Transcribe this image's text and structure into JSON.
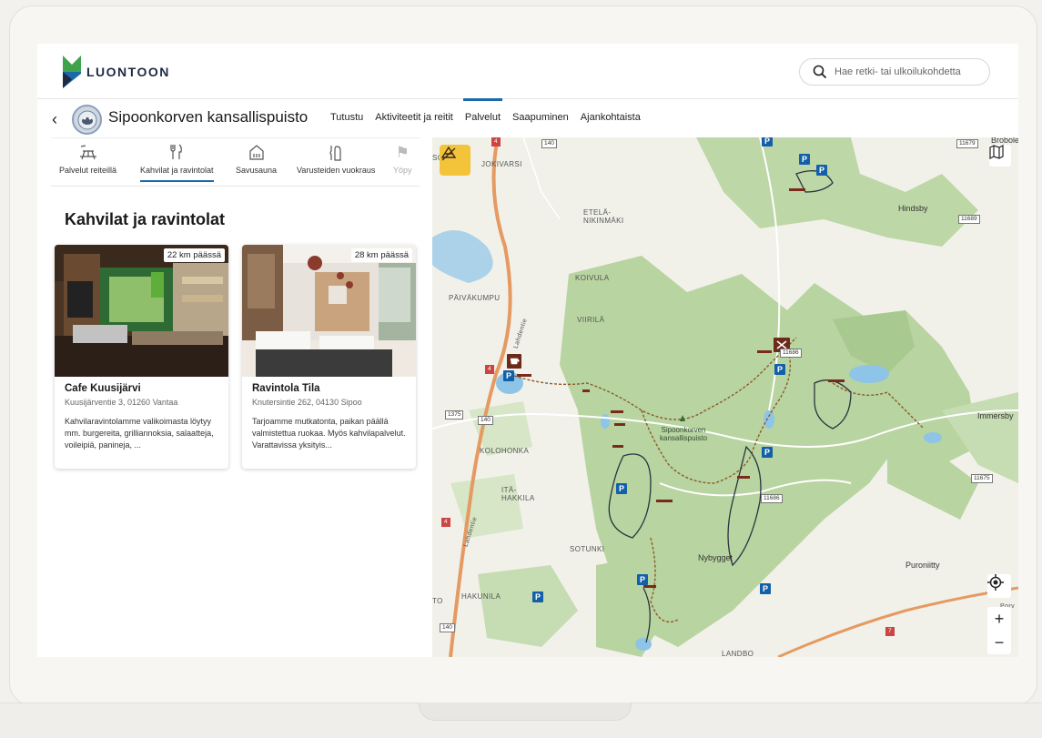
{
  "header": {
    "brand": "LUONTOON",
    "search_placeholder": "Hae retki- tai ulkoilukohdetta",
    "brand_colors": {
      "green": "#3fa34d",
      "blue": "#1a6aa9",
      "navy": "#1f2a44"
    }
  },
  "nav": {
    "park_title": "Sipoonkorven kansallispuisto",
    "tabs": [
      {
        "label": "Tutustu",
        "active": false
      },
      {
        "label": "Aktiviteetit ja reitit",
        "active": false
      },
      {
        "label": "Palvelut",
        "active": true
      },
      {
        "label": "Saapuminen",
        "active": false
      },
      {
        "label": "Ajankohtaista",
        "active": false
      }
    ]
  },
  "categories": [
    {
      "label": "Palvelut reiteillä",
      "icon": "picnic-table-icon",
      "active": false
    },
    {
      "label": "Kahvilat ja ravintolat",
      "icon": "fork-knife-icon",
      "active": true
    },
    {
      "label": "Savusauna",
      "icon": "sauna-icon",
      "active": false
    },
    {
      "label": "Varusteiden vuokraus",
      "icon": "equipment-icon",
      "active": false
    },
    {
      "label": "Yöpy",
      "icon": "tent-icon",
      "active": false
    }
  ],
  "section": {
    "title": "Kahvilat ja ravintolat"
  },
  "cards": [
    {
      "distance": "22 km päässä",
      "name": "Cafe Kuusijärvi",
      "address": "Kuusijärventie 3, 01260 Vantaa",
      "description": "Kahvilaravintolamme valikoimasta löytyy mm. burgereita, grilliannoksia, salaatteja, voileipiä, panineja, ..."
    },
    {
      "distance": "28 km päässä",
      "name": "Ravintola Tila",
      "address": "Knutersintie 262, 04130 Sipoo",
      "description": "Tarjoamme mutkatonta, paikan päällä valmistettua ruokaa. Myös kahvilapalvelut. Varattavissa yksityis..."
    }
  ],
  "map": {
    "labels": {
      "jokivarsi": "JOKIVARSI",
      "etela_nikinmaki": "ETELÄ-\nNIKINMÄKI",
      "koivula": "KOIVULA",
      "paivakumpu": "PÄIVÄKUMPU",
      "viirila": "VIIRILÄ",
      "kolohonka": "KOLOHONKA",
      "ita_hakkila": "ITÄ-\nHAKKILA",
      "sotunki": "SOTUNKI",
      "hakunila": "HAKUNILA",
      "hindsby": "Hindsby",
      "immersby": "Immersby",
      "nybygget": "Nybygget",
      "puroniitty": "Puroniitty",
      "brobole": "Brobole",
      "park": "Sipoonkorven\nkansallispuisto",
      "landbo": "LANDBO",
      "lahdentie": "Lahdentie",
      "porvoo": "Porv",
      "sc": "SC",
      "to": "TO"
    },
    "roads": {
      "r140a": "140",
      "r140b": "140",
      "r140c": "140",
      "r4a": "4",
      "r4b": "4",
      "r4c": "4",
      "r1375": "1375",
      "r11679": "11679",
      "r11689": "11689",
      "r11675": "11675",
      "r11686": "11686",
      "r11686b": "11686",
      "r7": "7"
    },
    "parking": "P",
    "colors": {
      "forest": "#b8d4a0",
      "land": "#f1f1ea",
      "water": "#8ec4e8",
      "trail": "#8b5a2b",
      "motorway": "#e59a62"
    }
  }
}
